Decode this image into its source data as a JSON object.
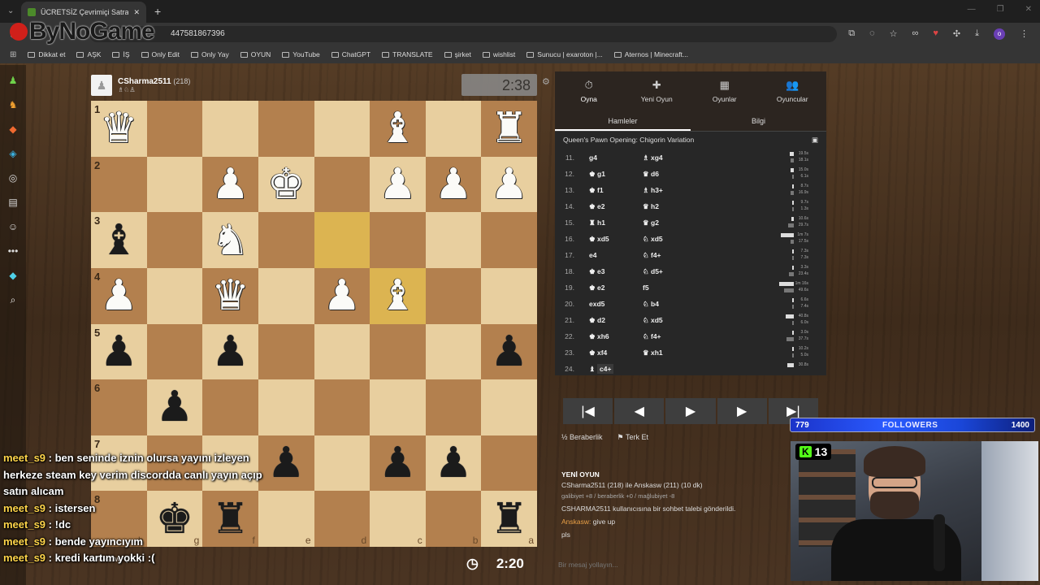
{
  "browser": {
    "tab_title": "ÜCRETSİZ Çevrimiçi Satranç Oy",
    "url": "447581867396",
    "logo_text": "ByNoGame",
    "profile_initial": "o",
    "bookmarks": [
      "Dikkat et",
      "AŞK",
      "İŞ",
      "Only Edit",
      "Only Yay",
      "OYUN",
      "YouTube",
      "ChatGPT",
      "TRANSLATE",
      "şirket",
      "wishlist",
      "Sunucu | exaroton |...",
      "Aternos | Minecraft..."
    ]
  },
  "players": {
    "top_name": "CSharma2511",
    "top_rating": "(218)",
    "top_clock": "2:38",
    "bottom_name": "Anskasw",
    "bottom_rating": "(211)",
    "bottom_clock": "2:20"
  },
  "board": {
    "ranks": [
      "1",
      "2",
      "3",
      "4",
      "5",
      "6",
      "7",
      "8"
    ],
    "files": [
      "h",
      "g",
      "f",
      "e",
      "d",
      "c",
      "b",
      "a"
    ],
    "rows": [
      [
        "wQ",
        "",
        "",
        "",
        "",
        "wB",
        "",
        "wR"
      ],
      [
        "",
        "",
        "wP",
        "wK",
        "",
        "wP",
        "wP",
        "wP"
      ],
      [
        "bB",
        "",
        "wN",
        "",
        "",
        "",
        "",
        ""
      ],
      [
        "wP",
        "",
        "wQ",
        "",
        "wP",
        "wB",
        "",
        ""
      ],
      [
        "bP",
        "",
        "bP",
        "",
        "",
        "",
        "",
        "bP"
      ],
      [
        "",
        "bP",
        "",
        "",
        "",
        "",
        "",
        ""
      ],
      [
        "",
        "",
        "",
        "bP",
        "",
        "bP",
        "bP",
        ""
      ],
      [
        "",
        "bK",
        "bR",
        "",
        "",
        "",
        "",
        "bR"
      ]
    ],
    "highlight": [
      [
        2,
        4
      ],
      [
        3,
        5
      ]
    ]
  },
  "panel": {
    "tabs": [
      {
        "icon": "⏱",
        "label": "Oyna"
      },
      {
        "icon": "✚",
        "label": "Yeni Oyun"
      },
      {
        "icon": "▦",
        "label": "Oyunlar"
      },
      {
        "icon": "👥",
        "label": "Oyuncular"
      }
    ],
    "subtabs": [
      "Hamleler",
      "Bilgi"
    ],
    "opening": "Queen's Pawn Opening: Chigorin Variation",
    "moves": [
      {
        "n": "11.",
        "w": "g4",
        "wp": "",
        "b": "xg4",
        "bp": "♗",
        "wt": "19.5s",
        "bt": "18.1s",
        "wf": 0.08,
        "bf": 0.07
      },
      {
        "n": "12.",
        "w": "g1",
        "wp": "♚",
        "b": "d6",
        "bp": "♛",
        "wt": "15.0s",
        "bt": "6.1s",
        "wf": 0.06,
        "bf": 0.03
      },
      {
        "n": "13.",
        "w": "f1",
        "wp": "♚",
        "b": "h3+",
        "bp": "♗",
        "wt": "8.7s",
        "bt": "16.9s",
        "wf": 0.04,
        "bf": 0.07
      },
      {
        "n": "14.",
        "w": "e2",
        "wp": "♚",
        "b": "h2",
        "bp": "♛",
        "wt": "9.7s",
        "bt": "1.3s",
        "wf": 0.04,
        "bf": 0.01
      },
      {
        "n": "15.",
        "w": "h1",
        "wp": "♜",
        "b": "g2",
        "bp": "♛",
        "wt": "10.6s",
        "bt": "29.7s",
        "wf": 0.05,
        "bf": 0.12
      },
      {
        "n": "16.",
        "w": "xd5",
        "wp": "♚",
        "b": "xd5",
        "bp": "♘",
        "wt": "1m 7s",
        "bt": "17.5s",
        "wf": 0.27,
        "bf": 0.07
      },
      {
        "n": "17.",
        "w": "e4",
        "wp": "",
        "b": "f4+",
        "bp": "♘",
        "wt": "7.3s",
        "bt": "7.3s",
        "wf": 0.03,
        "bf": 0.03
      },
      {
        "n": "18.",
        "w": "e3",
        "wp": "♚",
        "b": "d5+",
        "bp": "♘",
        "wt": "3.3s",
        "bt": "23.4s",
        "wf": 0.02,
        "bf": 0.1
      },
      {
        "n": "19.",
        "w": "e2",
        "wp": "♚",
        "b": "f5",
        "bp": "",
        "wt": "1m 16s",
        "bt": "49.6s",
        "wf": 0.3,
        "bf": 0.2
      },
      {
        "n": "20.",
        "w": "exd5",
        "wp": "",
        "b": "b4",
        "bp": "♘",
        "wt": "6.6s",
        "bt": "7.4s",
        "wf": 0.03,
        "bf": 0.03
      },
      {
        "n": "21.",
        "w": "d2",
        "wp": "♚",
        "b": "xd5",
        "bp": "♘",
        "wt": "40.8s",
        "bt": "6.0s",
        "wf": 0.17,
        "bf": 0.03
      },
      {
        "n": "22.",
        "w": "xh6",
        "wp": "♚",
        "b": "f4+",
        "bp": "♘",
        "wt": "3.0s",
        "bt": "37.7s",
        "wf": 0.01,
        "bf": 0.15
      },
      {
        "n": "23.",
        "w": "xf4",
        "wp": "♚",
        "b": "xh1",
        "bp": "♛",
        "wt": "10.2s",
        "bt": "5.0s",
        "wf": 0.04,
        "bf": 0.02
      },
      {
        "n": "24.",
        "w": "c4+",
        "wp": "♝",
        "b": "",
        "bp": "",
        "wt": "30.8s",
        "bt": "",
        "wf": 0.13,
        "bf": 0
      }
    ],
    "controls": [
      "|◀",
      "◀",
      "▶",
      "▶",
      "▶|"
    ],
    "draw_label": "Beraberlik",
    "resign_label": "Terk Et",
    "chat_header": "YENİ OYUN",
    "chat_lines": [
      "CSharma2511 (218) ile Anskasw (211) (10 dk)",
      "galibiyet +8 / beraberlik +0 / mağlubiyet -8"
    ],
    "chat_system": "CSHARMA2511 kullanıcısına bir sohbet talebi gönderildi.",
    "chat_msg_user": "Anskasw:",
    "chat_msg_text": "give up",
    "chat_pls": "pls",
    "input_placeholder": "Bir mesaj yollayın..."
  },
  "overlay_chat": [
    {
      "user": "meet_s9",
      "text": ": ben seninde iznin olursa yayını izleyen herkeze steam key verim discordda canlı yayın açıp satın alıcam"
    },
    {
      "user": "meet_s9",
      "text": ": istersen"
    },
    {
      "user": "meet_s9",
      "text": ": !dc"
    },
    {
      "user": "meet_s9",
      "text": ": bende yayıncıyım"
    },
    {
      "user": "meet_s9",
      "text": ": kredi kartım yokki :("
    }
  ],
  "stream": {
    "followers_current": "779",
    "followers_label": "FOLLOWERS",
    "followers_goal": "1400",
    "followers_progress": 0.556,
    "kick_viewers": "13"
  }
}
